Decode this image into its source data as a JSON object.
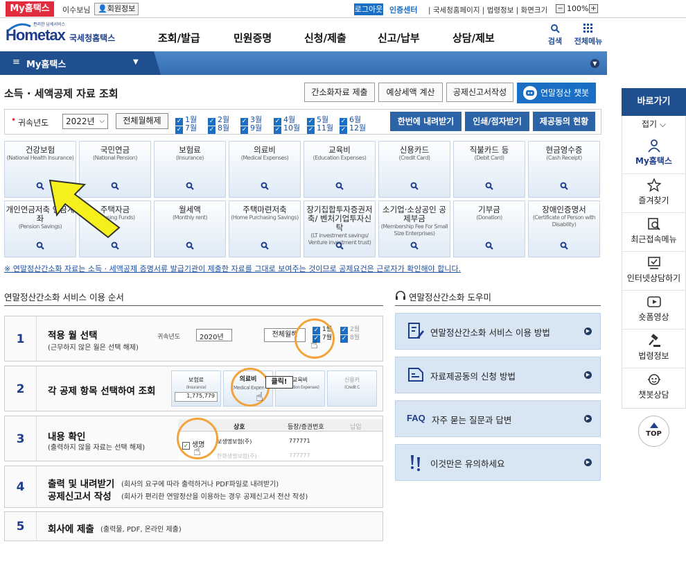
{
  "top": {
    "my_hometax": "My홈택스",
    "user": "이수보님",
    "userinfo": "회원정보",
    "logout": "로그아웃",
    "cert": "인증센터",
    "links": "| 국세청홈페이지 | 법령정보 | 화면크기",
    "zoom": "100%",
    "zoom_minus": "−",
    "zoom_plus": "+"
  },
  "logo": {
    "main": "Hometax",
    "sub": "국세청홈택스",
    "tag": "편리한 납세서비스"
  },
  "gnb": [
    "조회/발급",
    "민원증명",
    "신청/제출",
    "신고/납부",
    "상담/제보"
  ],
  "gnb_search": "검색",
  "gnb_allmenu": "전체메뉴",
  "bluebar": {
    "title": "My홈택스"
  },
  "title": "소득 · 세액공제 자료 조회",
  "top_buttons": [
    "간소화자료 제출",
    "예상세액 계산",
    "공제신고서작성"
  ],
  "chatbot": "연말정산 챗봇",
  "year": {
    "label": "귀속년도",
    "value": "2022년",
    "alloff": "전체월해제",
    "months": [
      "1월",
      "2월",
      "3월",
      "4월",
      "5월",
      "6월",
      "7월",
      "8월",
      "9월",
      "10월",
      "11월",
      "12월"
    ]
  },
  "actions": [
    "한번에 내려받기",
    "인쇄/점자받기",
    "제공동의 현황"
  ],
  "tiles": [
    {
      "k": "건강보험",
      "e": "(National Health Insurance)"
    },
    {
      "k": "국민연금",
      "e": "(National Pension)"
    },
    {
      "k": "보험료",
      "e": "(Insurance)"
    },
    {
      "k": "의료비",
      "e": "(Medical Expenses)"
    },
    {
      "k": "교육비",
      "e": "(Education Expenses)"
    },
    {
      "k": "신용카드",
      "e": "(Credit Card)"
    },
    {
      "k": "직불카드 등",
      "e": "(Debit Card)"
    },
    {
      "k": "현금영수증",
      "e": "(Cash Receipt)"
    },
    {
      "k": "개인연금저축 연금계좌",
      "e": "(Pension Savings)"
    },
    {
      "k": "주택자금",
      "e": "(Housing Funds)"
    },
    {
      "k": "월세액",
      "e": "(Monthly rent)"
    },
    {
      "k": "주택마련저축",
      "e": "(Home Purchasing Savings)"
    },
    {
      "k": "장기집합투자증권저축/ 벤처기업투자신탁",
      "e": "(LT investment savings/ Venture investment trust)"
    },
    {
      "k": "소기업·소상공인 공제부금",
      "e": "(Membership Fee For Small Size Enterprises)"
    },
    {
      "k": "기부금",
      "e": "(Donation)"
    },
    {
      "k": "장애인증명서",
      "e": "(Certificate of Person with Disability)"
    }
  ],
  "notice": "※ 연말정산간소화 자료는 소득 · 세액공제 증명서류 발급기관이 제출한 자료를 그대로 보여주는 것이므로 공제요건은 근로자가 확인해야 합니다.",
  "process": {
    "title": "연말정산간소화 서비스 이용 순서",
    "steps": [
      {
        "n": "1",
        "t": "적용 월 선택",
        "s": "(근무하지 않은 월은 선택 해제)"
      },
      {
        "n": "2",
        "t": "각 공제 항목 선택하여 조회",
        "s": ""
      },
      {
        "n": "3",
        "t": "내용 확인",
        "s": "(출력하지 않을 자료는 선택 해제)"
      },
      {
        "n": "4",
        "t": "출력 및 내려받기",
        "s": "(회사의 요구에 따라 출력하거나 PDF파일로 내려받기)",
        "t2": "공제신고서 작성",
        "s2": "(회사가 편리한 연말정산을 이용하는 경우 공제신고서 전산 작성)"
      },
      {
        "n": "5",
        "t": "회사에 제출",
        "s": "(출력물, PDF, 온라인 제출)"
      }
    ],
    "demo1": {
      "label": "귀속년도",
      "year": "2020년",
      "btn": "전체월해",
      "m": "1월",
      "m2": "7월",
      "m3": "2월",
      "m4": "8월"
    },
    "demo2": {
      "c1": "보험료",
      "c1e": "(Insurance)",
      "c2": "의료비",
      "c2e": "(Medical Expen",
      "c3": "교육비",
      "c3e": "(Education Expenses)",
      "c4": "신용카",
      "c4e": "(Credit C",
      "amount": "1,775,779",
      "tip": "클릭!"
    },
    "demo3": {
      "h1": "상호",
      "h2": "등장/증권번호",
      "h3": "납입",
      "row1": "보생명보험(주)",
      "row1v": "777771",
      "chk": "생명",
      "row2": "한화생명보험(주)",
      "row2v": "777777"
    }
  },
  "helper": {
    "title": "연말정산간소화 도우미",
    "items": [
      "연말정산간소화 서비스 이용 방법",
      "자료제공동의 신청 방법",
      "자주 묻는 질문과 답변",
      "이것만은 유의하세요"
    ],
    "faq": "FAQ"
  },
  "quick": {
    "head": "바로가기",
    "fold": "접기",
    "items": [
      "My홈택스",
      "즐겨찾기",
      "최근접속메뉴",
      "인터넷상담하기",
      "숏폼영상",
      "법령정보",
      "챗봇상담"
    ],
    "top": "TOP"
  },
  "colors": {
    "brand": "#1e3e8c",
    "accent": "#1a6fc4",
    "red": "#e02c3c",
    "orange": "#f2a33a",
    "arrow": "#f5f01c"
  }
}
